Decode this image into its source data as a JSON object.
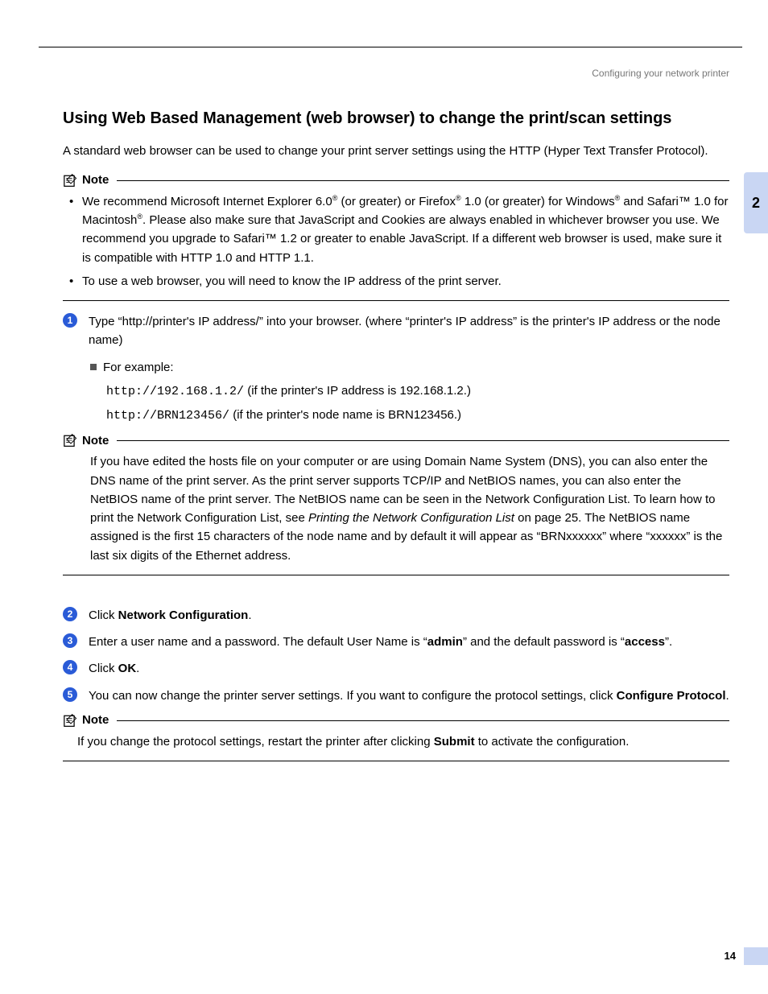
{
  "header": {
    "breadcrumb": "Configuring your network printer"
  },
  "sidebar": {
    "chapter": "2"
  },
  "footer": {
    "page": "14"
  },
  "title": "Using Web Based Management (web browser) to change the print/scan settings",
  "intro": "A standard web browser can be used to change your print server settings using the HTTP (Hyper Text Transfer Protocol).",
  "noteLabel": "Note",
  "note1": {
    "b1_a": "We recommend Microsoft Internet Explorer 6.0",
    "b1_b": " (or greater) or Firefox",
    "b1_c": " 1.0 (or greater) for Windows",
    "b1_d": " and Safari™ 1.0 for Macintosh",
    "b1_e": ". Please also make sure that JavaScript and Cookies are always enabled in whichever browser you use. We recommend you upgrade to Safari™ 1.2 or greater to enable JavaScript. If a different web browser is used, make sure it is compatible with HTTP 1.0 and HTTP 1.1.",
    "b2": "To use a web browser, you will need to know the IP address of the print server."
  },
  "step1": {
    "text": "Type “http://printer's IP address/” into your browser. (where “printer's IP address” is the printer's IP address or the node name)",
    "exLabel": "For example:",
    "ex1_code": "http://192.168.1.2/",
    "ex1_rest": " (if the printer's IP address is 192.168.1.2.)",
    "ex2_code": "http://BRN123456/",
    "ex2_rest": " (if the printer's node name is BRN123456.)"
  },
  "note2": {
    "body_a": "If you have edited the hosts file on your computer or are using Domain Name System (DNS), you can also enter the DNS name of the print server. As the print server supports TCP/IP and NetBIOS names, you can also enter the NetBIOS name of the print server. The NetBIOS name can be seen in the Network Configuration List. To learn how to print the Network Configuration List, see ",
    "body_link": "Printing the Network Configuration List",
    "body_b": " on page 25. The NetBIOS name assigned is the first 15 characters of the node name and by default it will appear as “BRNxxxxxx” where “xxxxxx” is the last six digits of the Ethernet address."
  },
  "step2": {
    "a": "Click ",
    "bold": "Network Configuration",
    "b": "."
  },
  "step3": {
    "a": "Enter a user name and a password. The default User Name is “",
    "u": "admin",
    "b": "” and the default password is “",
    "p": "access",
    "c": "”."
  },
  "step4": {
    "a": "Click ",
    "bold": "OK",
    "b": "."
  },
  "step5": {
    "a": "You can now change the printer server settings. If you want to configure the protocol settings, click ",
    "bold": "Configure Protocol",
    "b": "."
  },
  "note3": {
    "a": "If you change the protocol settings, restart the printer after clicking ",
    "bold": "Submit",
    "b": " to activate the configuration."
  }
}
